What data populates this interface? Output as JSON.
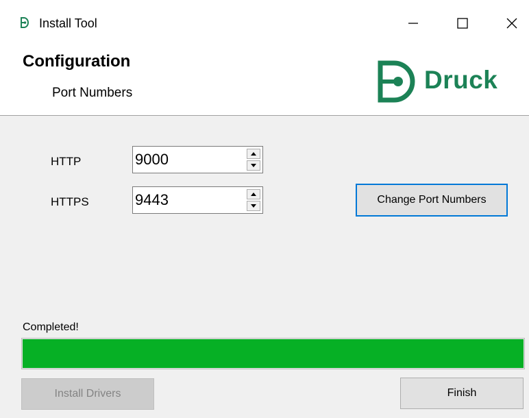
{
  "window": {
    "title": "Install Tool",
    "app_icon": "druck-logo-icon",
    "controls": {
      "minimize_icon": "minimize-icon",
      "maximize_icon": "maximize-icon",
      "close_icon": "close-icon"
    }
  },
  "header": {
    "title": "Configuration",
    "subtitle": "Port Numbers",
    "logo_text": "Druck",
    "brand_color": "#1c8256"
  },
  "ports": {
    "http": {
      "label": "HTTP",
      "value": "9000"
    },
    "https": {
      "label": "HTTPS",
      "value": "9443"
    },
    "change_button": "Change Port Numbers"
  },
  "status": {
    "text": "Completed!",
    "progress_fraction": 1.0,
    "progress_color": "#06b025"
  },
  "footer": {
    "install_drivers_label": "Install Drivers",
    "install_drivers_enabled": false,
    "finish_label": "Finish"
  },
  "colors": {
    "focus_border": "#0078d7",
    "window_background": "#f0f0f0"
  }
}
